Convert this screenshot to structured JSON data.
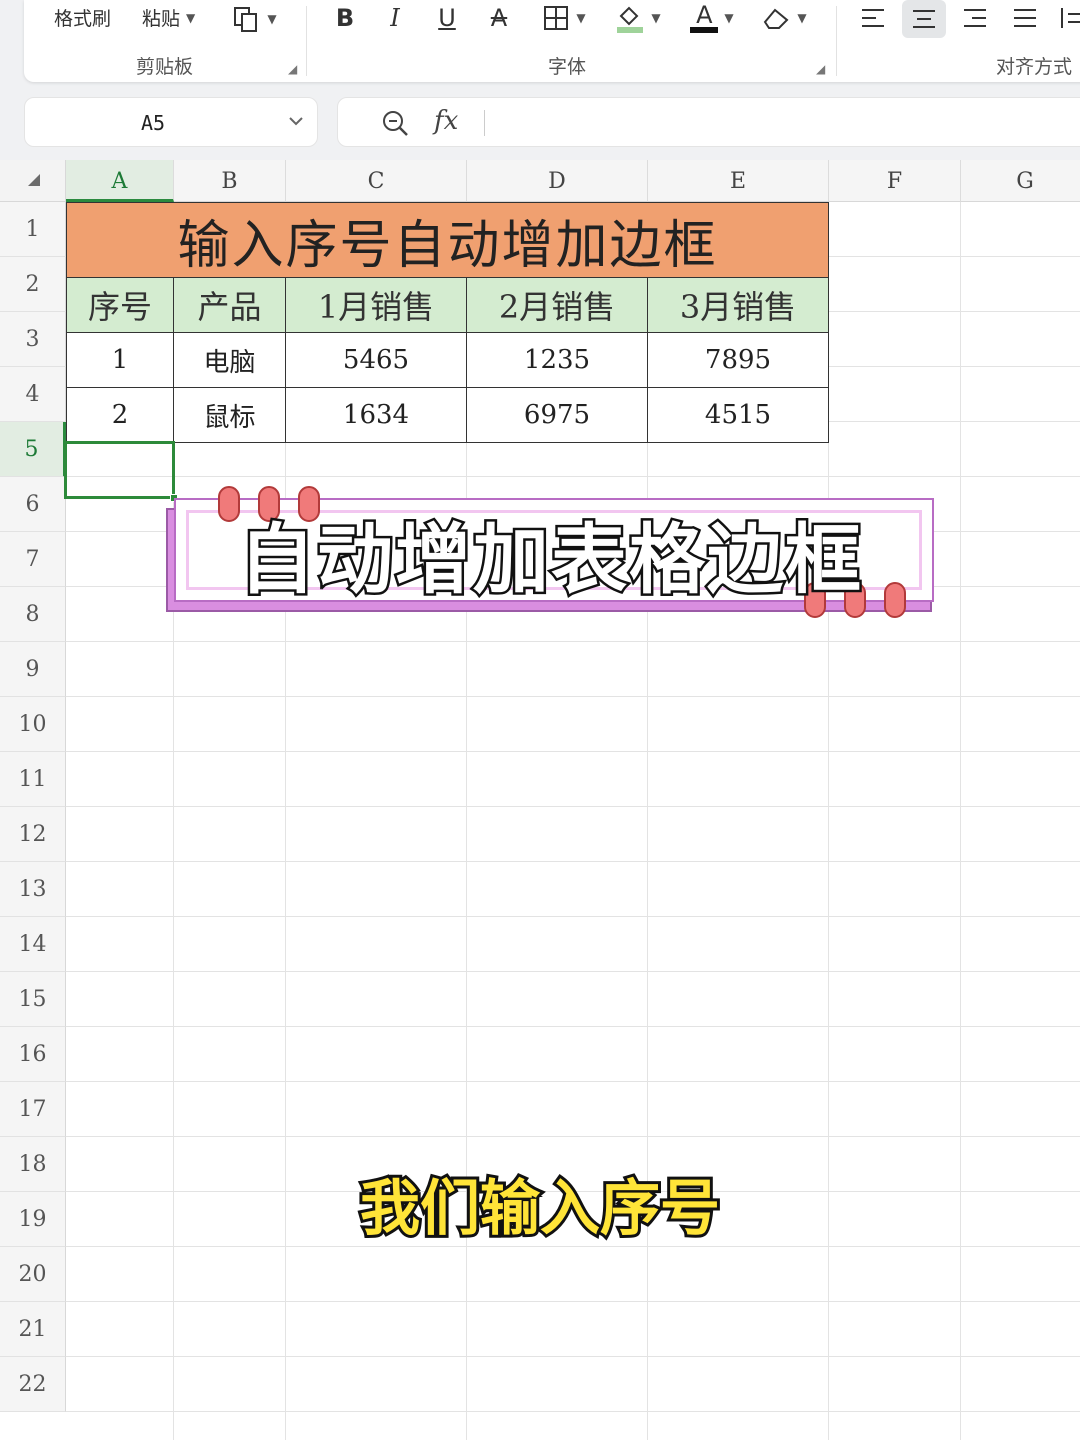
{
  "ribbon": {
    "format_painter": "格式刷",
    "paste": "粘贴",
    "clipboard_group": "剪贴板",
    "font_group": "字体",
    "align_group": "对齐方式",
    "bold": "B",
    "italic": "I",
    "underline": "U",
    "strikethrough": "A",
    "font_color_letter": "A",
    "font_color": "#111111",
    "fill_color": "#9fd39a"
  },
  "formula_bar": {
    "name_box": "A5",
    "fx_label": "fx",
    "formula": ""
  },
  "sheet": {
    "columns": [
      "A",
      "B",
      "C",
      "D",
      "E",
      "F",
      "G"
    ],
    "selected_column": "A",
    "rows": [
      "1",
      "2",
      "3",
      "4",
      "5",
      "6",
      "7",
      "8",
      "9",
      "10",
      "11",
      "12",
      "13",
      "14",
      "15",
      "16",
      "17",
      "18",
      "19",
      "20",
      "21",
      "22"
    ],
    "selected_row": "5",
    "table": {
      "title": "输入序号自动增加边框",
      "headers": [
        "序号",
        "产品",
        "1月销售",
        "2月销售",
        "3月销售"
      ],
      "rows": [
        [
          "1",
          "电脑",
          "5465",
          "1235",
          "7895"
        ],
        [
          "2",
          "鼠标",
          "1634",
          "6975",
          "4515"
        ]
      ],
      "title_color": "#f0a070",
      "header_color": "#d4ecd0"
    }
  },
  "overlay": {
    "banner": "自动增加表格边框",
    "subtitle": "我们输入序号",
    "subtitle_color": "#ffe438"
  }
}
